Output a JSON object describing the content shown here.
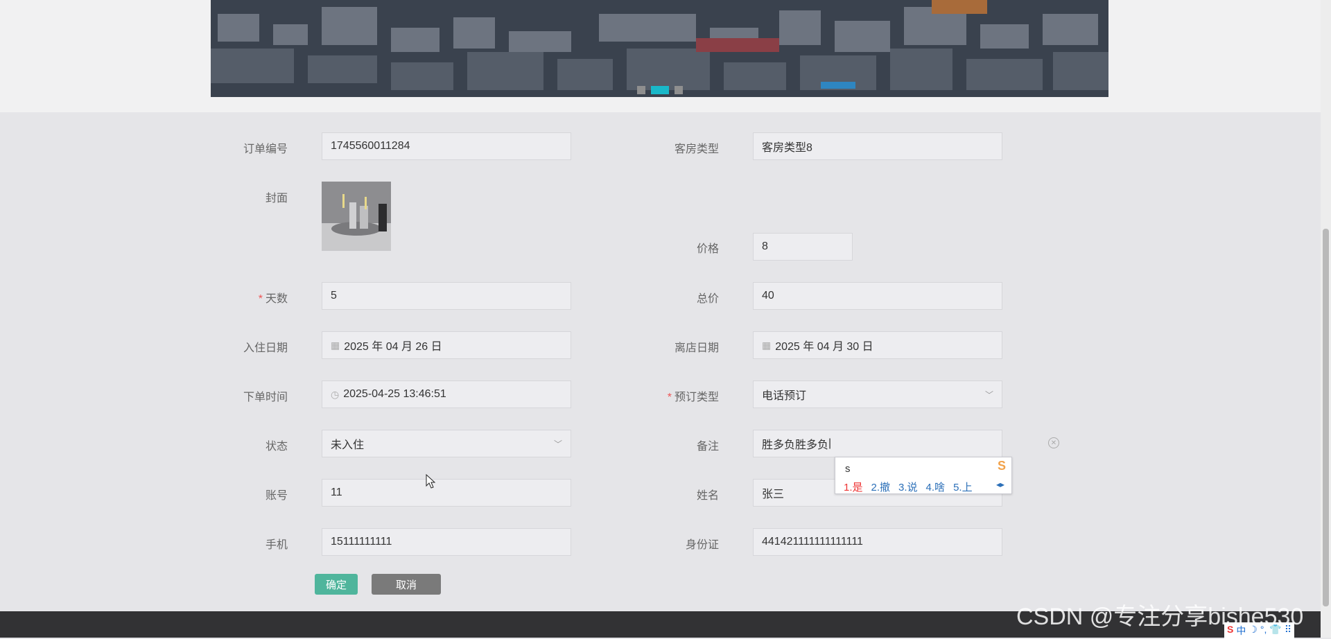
{
  "banner": {
    "slides": 3,
    "active_slide": 2
  },
  "form": {
    "order_no": {
      "label": "订单编号",
      "value": "1745560011284"
    },
    "room_type": {
      "label": "客房类型",
      "value": "客房类型8"
    },
    "cover": {
      "label": "封面"
    },
    "price": {
      "label": "价格",
      "value": "8"
    },
    "days": {
      "required": "*",
      "label": "天数",
      "value": "5"
    },
    "total": {
      "label": "总价",
      "value": "40"
    },
    "checkin": {
      "label": "入住日期",
      "value": "2025 年 04 月 26 日"
    },
    "checkout": {
      "label": "离店日期",
      "value": "2025 年 04 月 30 日"
    },
    "order_time": {
      "label": "下单时间",
      "value": "2025-04-25 13:46:51"
    },
    "booking_type": {
      "required": "*",
      "label": "预订类型",
      "value": "电话预订"
    },
    "status": {
      "label": "状态",
      "value": "未入住"
    },
    "remark": {
      "label": "备注",
      "value": "胜多负胜多负"
    },
    "account": {
      "label": "账号",
      "value": "11"
    },
    "name": {
      "label": "姓名",
      "value": "张三"
    },
    "phone": {
      "label": "手机",
      "value": "15111111111"
    },
    "id_card": {
      "label": "身份证",
      "value": "441421111111111111"
    }
  },
  "buttons": {
    "ok": "确定",
    "cancel": "取消"
  },
  "ime": {
    "input": "s",
    "candidates": [
      "1.是",
      "2.撤",
      "3.说",
      "4.啥",
      "5.上"
    ]
  },
  "watermark": "CSDN @专注分享bishe530",
  "tray": [
    "S",
    "中",
    "☽",
    "°,",
    "👕",
    "⠿"
  ],
  "colors": {
    "confirm": "#4fb59c",
    "cancel": "#7a7a7a",
    "active_dot": "#19b8c9",
    "footer": "#323234"
  }
}
